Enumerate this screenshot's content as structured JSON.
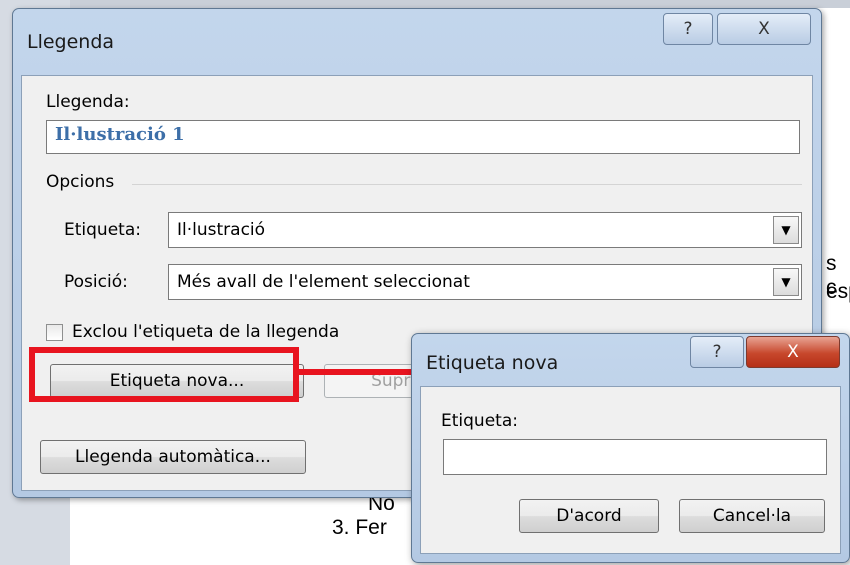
{
  "document": {
    "fragment_1": "s c",
    "fragment_2": "esp",
    "fragment_3": "No",
    "list_item": "3.  Fer"
  },
  "caption_dialog": {
    "title": "Llegenda",
    "help_button": "?",
    "close_button": "X",
    "caption_label": "Llegenda:",
    "caption_value": "Il·lustració 1",
    "options_group": "Opcions",
    "label_field": {
      "label": "Etiqueta:",
      "value": "Il·lustració"
    },
    "position_field": {
      "label": "Posició:",
      "value": "Més avall de l'element seleccionat"
    },
    "exclude_checkbox": {
      "label": "Exclou l'etiqueta de la llegenda",
      "checked": false
    },
    "new_label_button": "Etiqueta nova...",
    "delete_label_button": "Suprimeix",
    "autocaption_button": "Llegenda automàtica...",
    "dropdown_glyph": "▼"
  },
  "new_label_dialog": {
    "title": "Etiqueta nova",
    "help_button": "?",
    "close_button": "X",
    "label_prompt": "Etiqueta:",
    "label_value": "",
    "ok_button": "D'acord",
    "cancel_button": "Cancel·la"
  },
  "colors": {
    "highlight": "#e8141f",
    "caption_text": "#3d6fa8",
    "title_bar": "#c3d6ec"
  }
}
